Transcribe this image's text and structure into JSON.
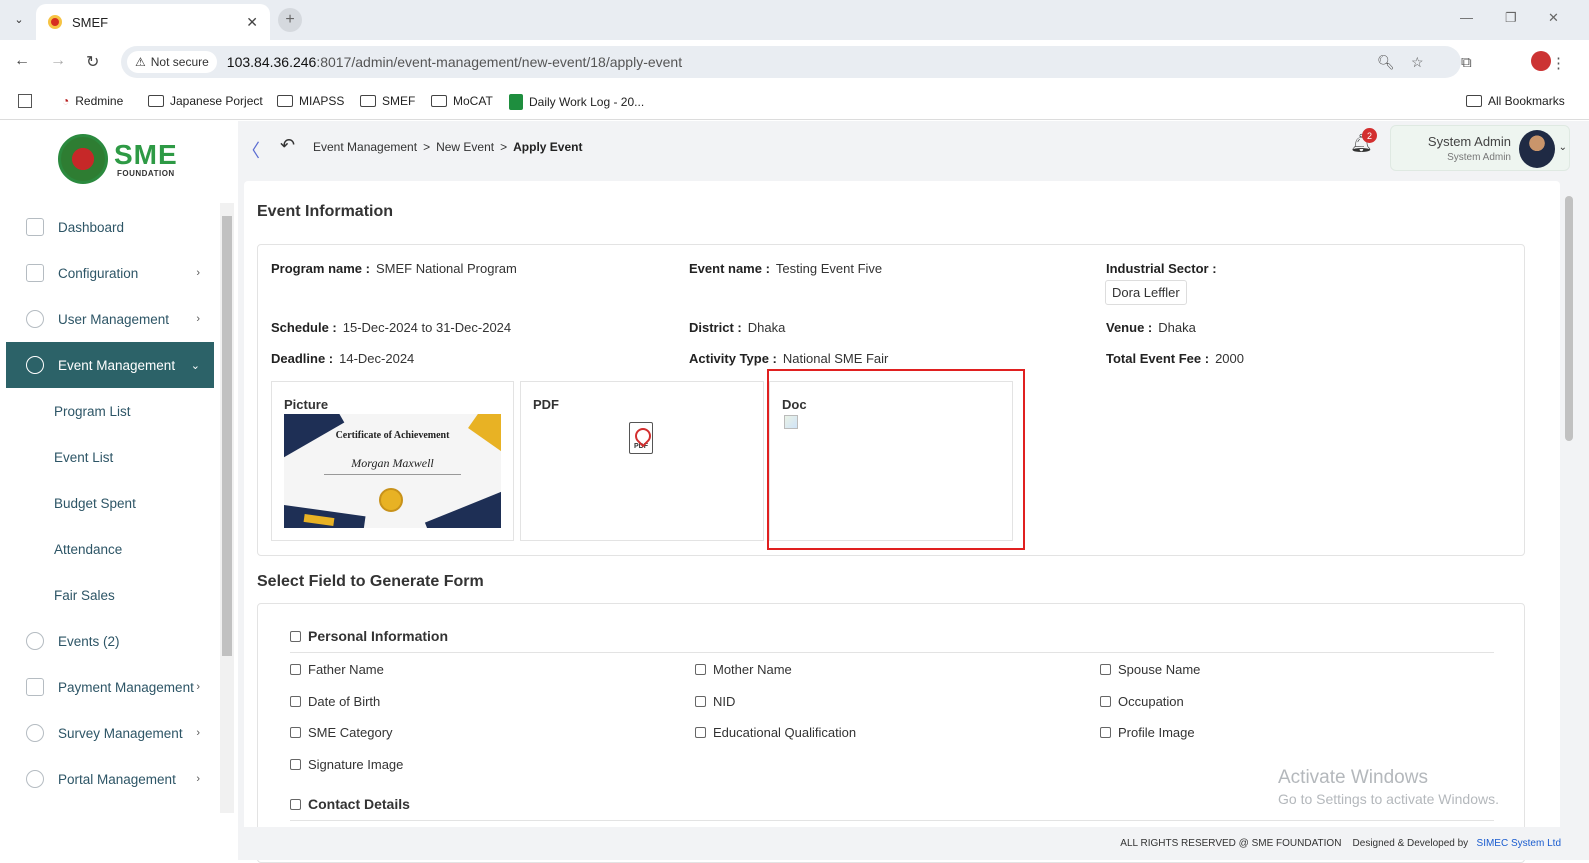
{
  "browser": {
    "tab_title": "SMEF",
    "security_label": "Not secure",
    "url_host": "103.84.36.246",
    "url_rest": ":8017/admin/event-management/new-event/18/apply-event",
    "bookmarks": [
      "Redmine",
      "Japanese Porject",
      "MIAPSS",
      "SMEF",
      "MoCAT",
      "Daily Work Log - 20..."
    ],
    "all_bookmarks": "All Bookmarks"
  },
  "logo": {
    "sme": "SME",
    "foundation": "FOUNDATION"
  },
  "sidebar": {
    "items": [
      {
        "label": "Dashboard",
        "chevron": ""
      },
      {
        "label": "Configuration",
        "chevron": "›"
      },
      {
        "label": "User Management",
        "chevron": "›"
      },
      {
        "label": "Event Management",
        "chevron": "⌄"
      }
    ],
    "submenu": [
      "Program List",
      "Event List",
      "Budget Spent",
      "Attendance",
      "Fair Sales"
    ],
    "items_after": [
      {
        "label": "Events (2)",
        "chevron": ""
      },
      {
        "label": "Payment Management",
        "chevron": "›"
      },
      {
        "label": "Survey Management",
        "chevron": "›"
      },
      {
        "label": "Portal Management",
        "chevron": "›"
      }
    ]
  },
  "topbar": {
    "breadcrumb": [
      "Event Management",
      "New Event",
      "Apply Event"
    ],
    "sep": ">",
    "notif_count": "2",
    "user_name": "System Admin",
    "user_role": "System Admin"
  },
  "event_info": {
    "title": "Event Information",
    "program_label": "Program name :",
    "program": "SMEF National Program",
    "event_label": "Event name :",
    "event": "Testing Event Five",
    "sector_label": "Industrial Sector :",
    "sector": "Dora Leffler",
    "schedule_label": "Schedule :",
    "schedule": "15-Dec-2024 to 31-Dec-2024",
    "district_label": "District :",
    "district": "Dhaka",
    "venue_label": "Venue :",
    "venue": "Dhaka",
    "deadline_label": "Deadline :",
    "deadline": "14-Dec-2024",
    "activity_label": "Activity Type :",
    "activity": "National SME Fair",
    "fee_label": "Total Event Fee :",
    "fee": "2000",
    "attachments": {
      "picture": "Picture",
      "pdf": "PDF",
      "doc": "Doc"
    },
    "certificate": {
      "title": "Certificate of Achievement",
      "name": "Morgan Maxwell"
    },
    "pdf_icon_text": "PDF"
  },
  "form": {
    "title": "Select Field to Generate Form",
    "personal": "Personal Information",
    "personal_fields": [
      "Father Name",
      "Mother Name",
      "Spouse Name",
      "Date of Birth",
      "NID",
      "Occupation",
      "SME Category",
      "Educational Qualification",
      "Profile Image",
      "Signature Image"
    ],
    "contact": "Contact Details"
  },
  "watermark": {
    "line1": "Activate Windows",
    "line2": "Go to Settings to activate Windows."
  },
  "footer": {
    "rights": "ALL RIGHTS RESERVED @ SME FOUNDATION",
    "designed": "Designed & Developed by",
    "company": "SIMEC System Ltd"
  }
}
